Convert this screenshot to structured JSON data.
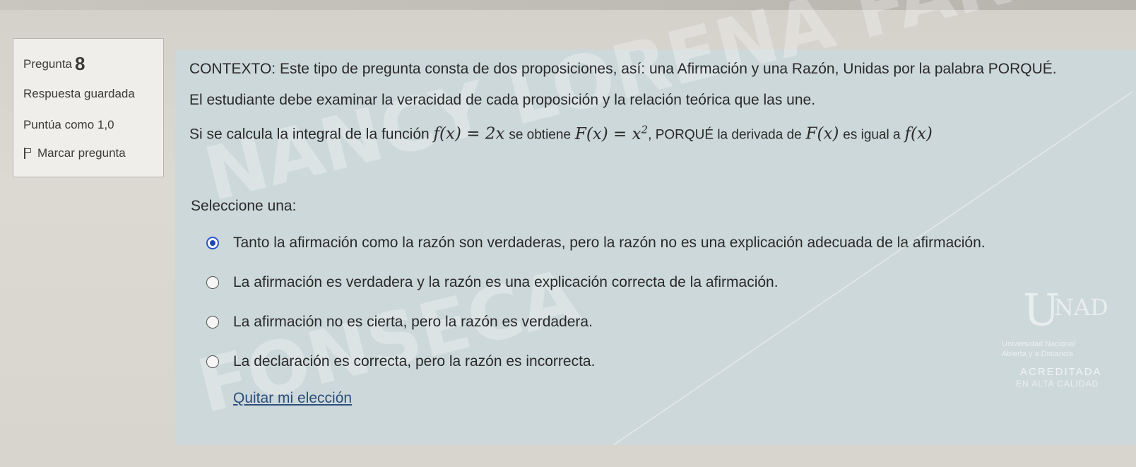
{
  "info": {
    "question_label": "Pregunta",
    "question_number": "8",
    "status": "Respuesta guardada",
    "score": "Puntúa como 1,0",
    "flag_label": "Marcar pregunta"
  },
  "question": {
    "context": "CONTEXTO: Este tipo de pregunta consta de dos proposiciones, así: una Afirmación y una Razón, Unidas por la palabra PORQUÉ.",
    "instruction": "El estudiante debe examinar la veracidad de cada proposición y la relación teórica que las une.",
    "stmt_part1": "Si se calcula la integral de la función",
    "stmt_math1": "f(x) = 2x",
    "stmt_part2": "se obtiene",
    "stmt_math2_base": "F(x) = x",
    "stmt_math2_exp": "2",
    "stmt_part3": ", PORQUÉ la derivada de",
    "stmt_math3": "F(x)",
    "stmt_part4": "es igual a",
    "stmt_math4": "f(x)"
  },
  "select_label": "Seleccione una:",
  "options": [
    {
      "label": "Tanto la afirmación como la razón son verdaderas, pero la razón no es una explicación adecuada de la afirmación.",
      "checked": true
    },
    {
      "label": "La afirmación es verdadera y la razón es una explicación correcta de la afirmación.",
      "checked": false
    },
    {
      "label": "La afirmación no es cierta, pero la razón es verdadera.",
      "checked": false
    },
    {
      "label": "La declaración es correcta, pero la razón es incorrecta.",
      "checked": false
    }
  ],
  "clear_choice": "Quitar mi elección",
  "watermark": {
    "line1": "NANCY LORENA FARFAN",
    "line2": "FONSECA"
  },
  "logo": {
    "u": "U",
    "nad": "NAD",
    "sub1": "Universidad Nacional",
    "sub2": "Abierta y a Distancia",
    "acc1": "ACREDITADA",
    "acc2": "EN ALTA CALIDAD"
  },
  "colors": {
    "content_bg": "#cdd8da",
    "radio_selected": "#1f47b8",
    "link": "#2c4e7c"
  }
}
